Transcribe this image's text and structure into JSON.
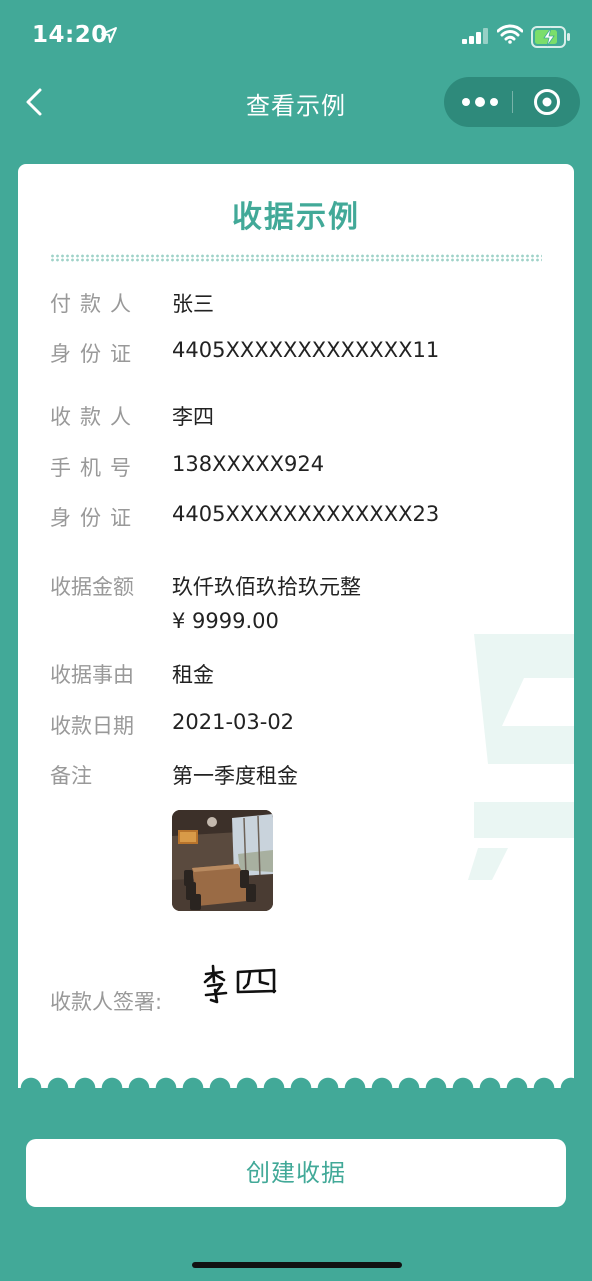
{
  "status_bar": {
    "time": "14:20"
  },
  "nav": {
    "title": "查看示例"
  },
  "receipt": {
    "title": "收据示例",
    "payer_label": "付款人",
    "payer_name": "张三",
    "payer_id_label": "身份证",
    "payer_id": "4405XXXXXXXXXXXXX11",
    "payee_label": "收款人",
    "payee_name": "李四",
    "phone_label": "手机号",
    "phone": "138XXXXX924",
    "payee_id_label": "身份证",
    "payee_id": "4405XXXXXXXXXXXXX23",
    "amount_label": "收据金额",
    "amount_words": "玖仟玖佰玖拾玖元整",
    "amount_number": "¥ 9999.00",
    "reason_label": "收据事由",
    "reason": "租金",
    "date_label": "收款日期",
    "date": "2021-03-02",
    "remark_label": "备注",
    "remark": "第一季度租金",
    "signature_label": "收款人签署:",
    "signature_text": "李四"
  },
  "actions": {
    "create_label": "创建收据"
  },
  "colors": {
    "theme_green": "#42a998",
    "capsule_bg": "#2e8a7b",
    "label_gray": "#999999",
    "value_dark": "#222222"
  },
  "icons": {
    "location": "location-arrow-icon",
    "signal": "signal-icon",
    "wifi": "wifi-icon",
    "battery": "battery-charging-icon",
    "back": "chevron-left-icon",
    "more": "more-dots-icon",
    "close": "miniprogram-close-icon"
  }
}
